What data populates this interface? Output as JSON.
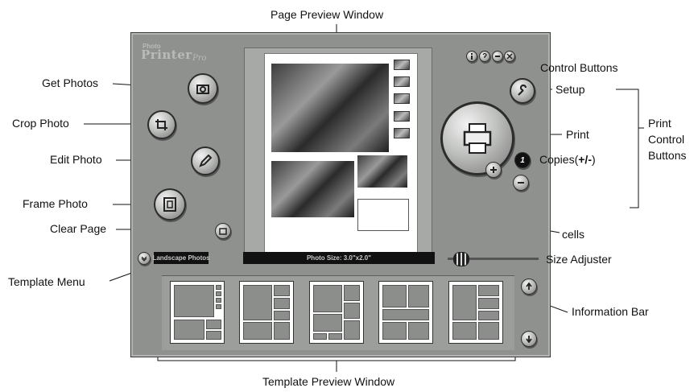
{
  "labels": {
    "page_preview_window": "Page Preview Window",
    "get_photos": "Get Photos",
    "crop_photo": "Crop Photo",
    "edit_photo": "Edit Photo",
    "frame_photo": "Frame Photo",
    "clear_page": "Clear Page",
    "template_menu": "Template Menu",
    "control_buttons": "Control Buttons",
    "setup": "Setup",
    "print": "Print",
    "print_control_buttons_1": "Print",
    "print_control_buttons_2": "Control",
    "print_control_buttons_3": "Buttons",
    "copies": "Copies(",
    "copies_pm": "+/-",
    "copies_end": ")",
    "cells": "cells",
    "size_adjuster": "Size Adjuster",
    "information_bar": "Information Bar",
    "template_preview_window": "Template Preview Window"
  },
  "app": {
    "logo_sub": "Photo",
    "logo": "Printer",
    "logo_sig": "Pro",
    "template_menu_value": "Landscape Photos",
    "info_bar_text": "Photo Size: 3.0\"x2.0\"",
    "copies_count": "1"
  },
  "icons": {
    "control": [
      "info-icon",
      "help-icon",
      "minimize-icon",
      "close-icon"
    ],
    "setup": "wrench-icon",
    "print": "printer-icon"
  },
  "colors": {
    "window_bg": "#8f918e",
    "bar_bg": "#111111",
    "label_text": "#111111"
  }
}
